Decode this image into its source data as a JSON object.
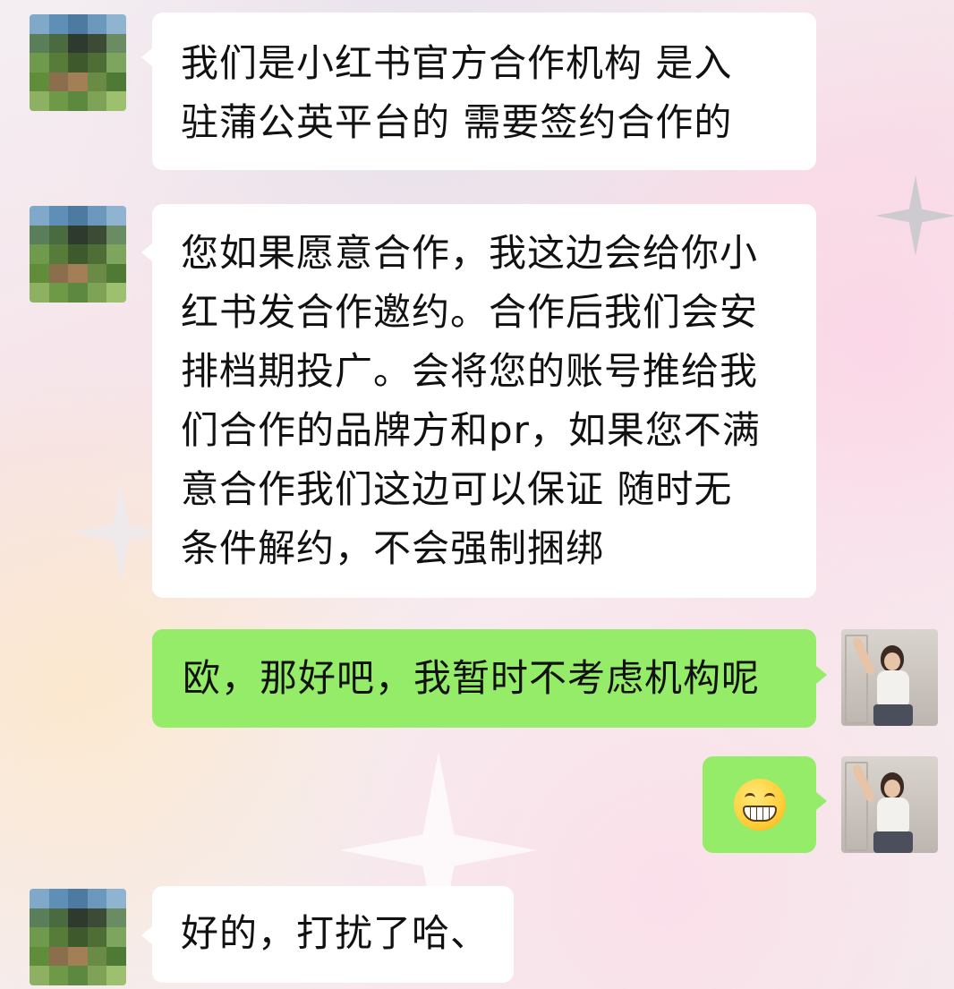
{
  "chat": {
    "messages": [
      {
        "sender": "contact",
        "text": "我们是小红书官方合作机构 是入\n驻蒲公英平台的 需要签约合作的"
      },
      {
        "sender": "contact",
        "text": "您如果愿意合作，我这边会给你小\n红书发合作邀约。合作后我们会安\n排档期投广。会将您的账号推给我\n们合作的品牌方和pr，如果您不满\n意合作我们这边可以保证 随时无\n条件解约，不会强制捆绑"
      },
      {
        "sender": "me",
        "text": "欧，那好吧，我暂时不考虑机构呢"
      },
      {
        "sender": "me",
        "text": "",
        "emoji": "grinning-face-emoji"
      },
      {
        "sender": "contact",
        "text": "好的，打扰了哈、"
      }
    ]
  },
  "colors": {
    "incoming_bubble": "#ffffff",
    "outgoing_bubble": "#95ec69",
    "text": "#111111"
  }
}
